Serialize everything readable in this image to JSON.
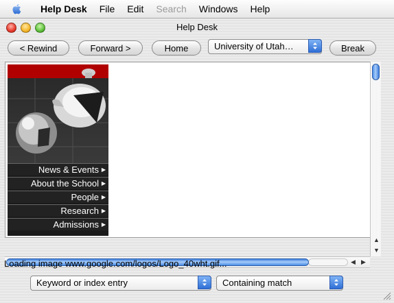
{
  "menubar": {
    "app_name": "Help Desk",
    "items": [
      "File",
      "Edit",
      "Search",
      "Windows",
      "Help"
    ]
  },
  "window": {
    "title": "Help Desk"
  },
  "toolbar": {
    "rewind_label": "< Rewind",
    "forward_label": "Forward >",
    "home_label": "Home",
    "location_selected": "University of Utah…",
    "break_label": "Break"
  },
  "webpage": {
    "nav_items": [
      "News & Events",
      "About the School",
      "People",
      "Research",
      "Admissions"
    ]
  },
  "status": {
    "text": "Loading image www.google.com/logos/Logo_40wht.gif..."
  },
  "search": {
    "type_selected": "Keyword or index entry",
    "match_selected": "Containing match"
  },
  "colors": {
    "accent": "#3c7ddc",
    "header_red": "#b00000"
  }
}
